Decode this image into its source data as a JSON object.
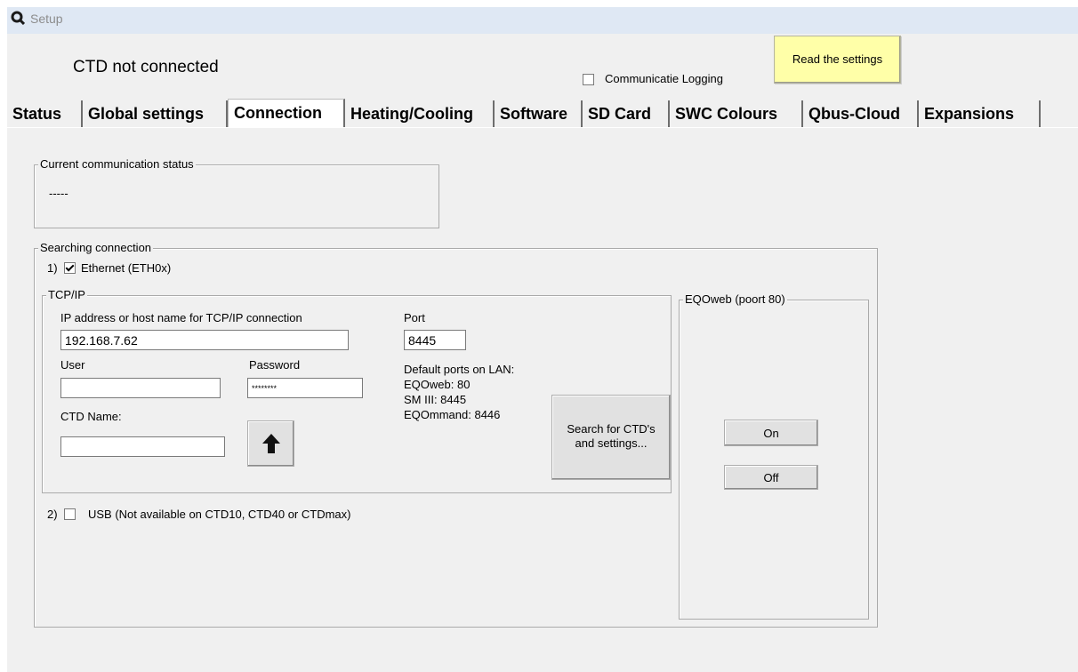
{
  "window": {
    "title": "Setup",
    "icon": "magnifier-logo-icon"
  },
  "header": {
    "status": "CTD not connected",
    "logging_label": "Communicatie Logging",
    "logging_checked": false,
    "read_button": "Read the settings"
  },
  "tabs": [
    {
      "label": "Status"
    },
    {
      "label": "Global settings"
    },
    {
      "label": "Connection",
      "active": true
    },
    {
      "label": "Heating/Cooling"
    },
    {
      "label": "Software"
    },
    {
      "label": "SD Card"
    },
    {
      "label": "SWC Colours"
    },
    {
      "label": "Qbus-Cloud"
    },
    {
      "label": "Expansions"
    }
  ],
  "current_status": {
    "legend": "Current communication status",
    "value": "-----"
  },
  "searching": {
    "legend": "Searching connection",
    "option1_prefix": "1)",
    "option1_label": "Ethernet (ETH0x)",
    "option1_checked": true,
    "option2_prefix": "2)",
    "option2_label": "USB (Not available on CTD10, CTD40 or CTDmax)",
    "option2_checked": false
  },
  "tcpip": {
    "legend": "TCP/IP",
    "ip_label": "IP address or host name for TCP/IP connection",
    "ip_value": "192.168.7.62",
    "port_label": "Port",
    "port_value": "8445",
    "user_label": "User",
    "user_value": "",
    "password_label": "Password",
    "password_value": "********",
    "ctd_name_label": "CTD Name:",
    "ctd_name_value": "",
    "upload_icon": "arrow-up-icon",
    "default_ports_title": "Default ports on LAN:",
    "default_ports": [
      "EQOweb: 80",
      "SM III: 8445",
      "EQOmmand: 8446"
    ],
    "search_button_line1": "Search for CTD's",
    "search_button_line2": "and settings..."
  },
  "eqoweb": {
    "legend": "EQOweb (poort 80)",
    "on_label": "On",
    "off_label": "Off"
  }
}
